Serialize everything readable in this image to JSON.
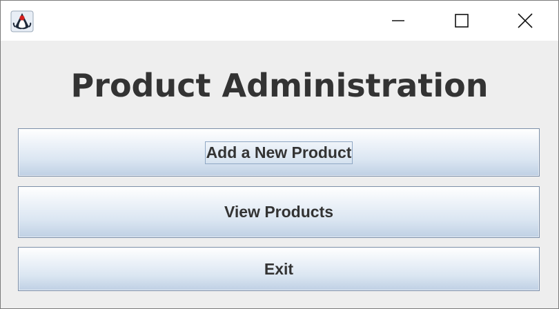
{
  "window": {
    "title": "",
    "icon": "java-duke-icon",
    "controls": {
      "minimize_icon": "minimize-icon",
      "maximize_icon": "maximize-icon",
      "close_icon": "close-icon"
    }
  },
  "main": {
    "heading": "Product Administration",
    "buttons": {
      "add_label": "Add a New Product",
      "view_label": "View Products",
      "exit_label": "Exit"
    }
  },
  "colors": {
    "background": "#eeeeee",
    "titlebar": "#ffffff",
    "text": "#333333",
    "button_border": "#7b8ea8",
    "button_gradient_top": "#ffffff",
    "button_gradient_bottom": "#bfd0e4"
  }
}
